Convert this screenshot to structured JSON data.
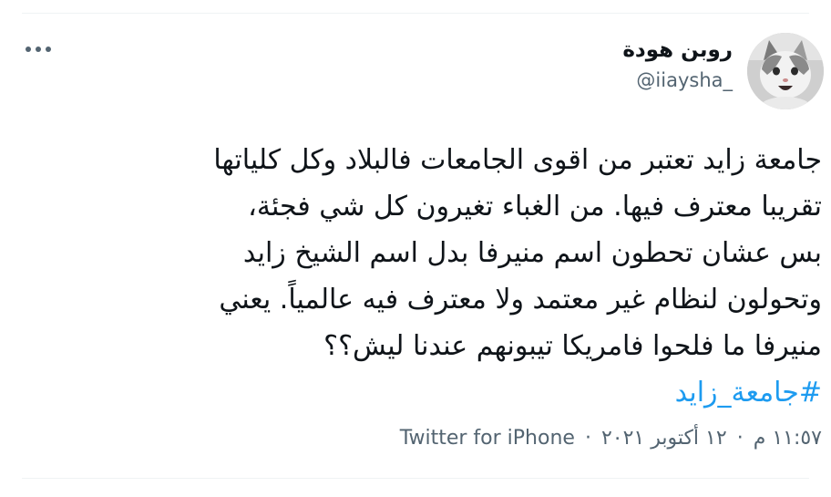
{
  "tweet": {
    "author": {
      "display_name": "روبن هودة",
      "handle": "@iiaysha_",
      "avatar_icon": "cat-avatar-icon"
    },
    "more_icon": "more-dots-icon",
    "text_lines": [
      "جامعة زايد تعتبر من اقوى الجامعات فالبلاد وكل كلياتها",
      "تقريبا معترف فيها.  من الغباء تغيرون كل شي فجئة،",
      "بس عشان تحطون اسم منيرفا بدل اسم الشيخ زايد",
      "وتحولون لنظام غير معتمد ولا معترف فيه عالمياً. يعني",
      "منيرفا ما فلحوا فامريكا تيبونهم عندنا ليش؟؟"
    ],
    "hashtag": "#جامعة_زايد",
    "meta": {
      "time": "١١:٥٧ م",
      "date": "١٢ أكتوبر ٢٠٢١",
      "separator": "·",
      "source": "Twitter for iPhone"
    }
  },
  "colors": {
    "text": "#0f1419",
    "secondary": "#536471",
    "link": "#1d9bf0",
    "divider": "#eff3f4"
  }
}
